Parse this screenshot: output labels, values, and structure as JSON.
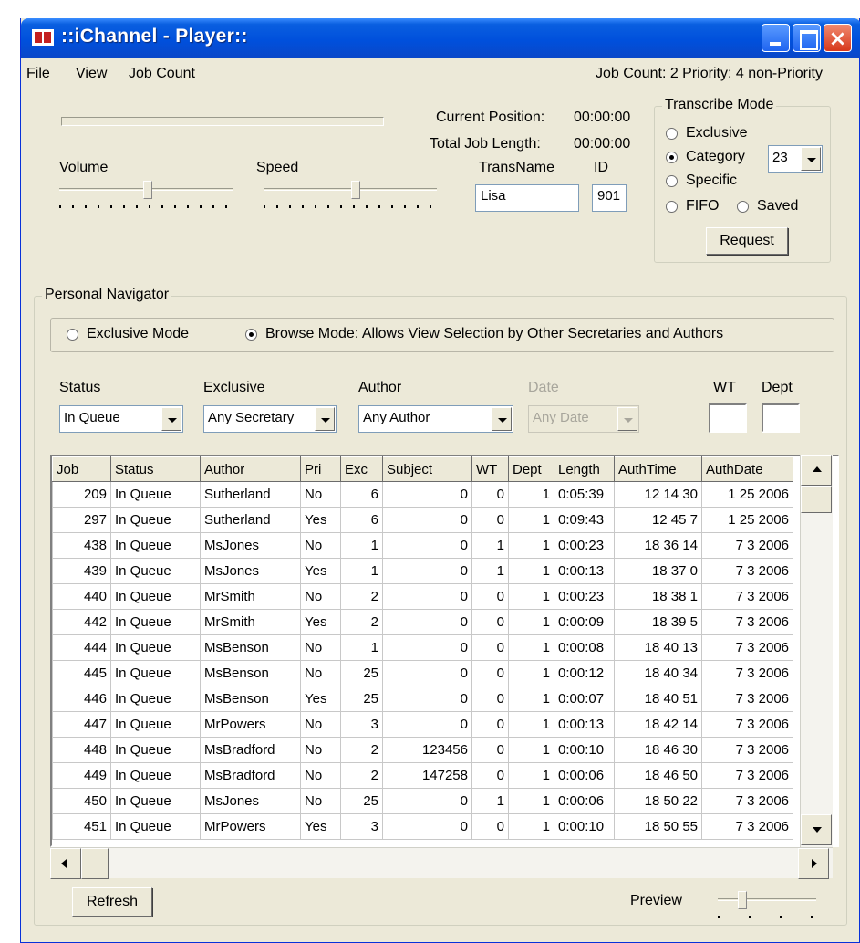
{
  "window": {
    "title": "::iChannel - Player::",
    "close_glyph": "×"
  },
  "menu": {
    "file": "File",
    "view": "View",
    "job_count": "Job Count"
  },
  "job_count_status": "Job Count: 2 Priority; 4 non-Priority",
  "player": {
    "current_position_label": "Current Position:",
    "current_position_value": "00:00:00",
    "total_length_label": "Total Job Length:",
    "total_length_value": "00:00:00",
    "volume_label": "Volume",
    "speed_label": "Speed",
    "transname_label": "TransName",
    "transname_value": "Lisa",
    "id_label": "ID",
    "id_value": "901"
  },
  "transcribe_mode": {
    "title": "Transcribe Mode",
    "exclusive": "Exclusive",
    "category": "Category",
    "category_value": "23",
    "specific": "Specific",
    "fifo": "FIFO",
    "saved": "Saved",
    "request_button": "Request",
    "selected": "Category"
  },
  "navigator": {
    "title": "Personal Navigator",
    "exclusive_mode": "Exclusive Mode",
    "browse_mode": "Browse Mode:  Allows View Selection by Other Secretaries and Authors",
    "selected_mode": "Browse Mode"
  },
  "filters": {
    "status_label": "Status",
    "status_value": "In Queue",
    "exclusive_label": "Exclusive",
    "exclusive_value": "Any Secretary",
    "author_label": "Author",
    "author_value": "Any Author",
    "date_label": "Date",
    "date_value": "Any Date",
    "wt_label": "WT",
    "dept_label": "Dept"
  },
  "table": {
    "columns": [
      "Job",
      "Status",
      "Author",
      "Pri",
      "Exc",
      "Subject",
      "WT",
      "Dept",
      "Length",
      "AuthTime",
      "AuthDate"
    ],
    "rows": [
      [
        "209",
        "In Queue",
        "Sutherland",
        "No",
        "6",
        "0",
        "0",
        "1",
        "0:05:39",
        "12 14 30",
        "1 25 2006"
      ],
      [
        "297",
        "In Queue",
        "Sutherland",
        "Yes",
        "6",
        "0",
        "0",
        "1",
        "0:09:43",
        "12 45 7",
        "1 25 2006"
      ],
      [
        "438",
        "In Queue",
        "MsJones",
        "No",
        "1",
        "0",
        "1",
        "1",
        "0:00:23",
        "18 36 14",
        "7 3 2006"
      ],
      [
        "439",
        "In Queue",
        "MsJones",
        "Yes",
        "1",
        "0",
        "1",
        "1",
        "0:00:13",
        "18 37 0",
        "7 3 2006"
      ],
      [
        "440",
        "In Queue",
        "MrSmith",
        "No",
        "2",
        "0",
        "0",
        "1",
        "0:00:23",
        "18 38 1",
        "7 3 2006"
      ],
      [
        "442",
        "In Queue",
        "MrSmith",
        "Yes",
        "2",
        "0",
        "0",
        "1",
        "0:00:09",
        "18 39 5",
        "7 3 2006"
      ],
      [
        "444",
        "In Queue",
        "MsBenson",
        "No",
        "1",
        "0",
        "0",
        "1",
        "0:00:08",
        "18 40 13",
        "7 3 2006"
      ],
      [
        "445",
        "In Queue",
        "MsBenson",
        "No",
        "25",
        "0",
        "0",
        "1",
        "0:00:12",
        "18 40 34",
        "7 3 2006"
      ],
      [
        "446",
        "In Queue",
        "MsBenson",
        "Yes",
        "25",
        "0",
        "0",
        "1",
        "0:00:07",
        "18 40 51",
        "7 3 2006"
      ],
      [
        "447",
        "In Queue",
        "MrPowers",
        "No",
        "3",
        "0",
        "0",
        "1",
        "0:00:13",
        "18 42 14",
        "7 3 2006"
      ],
      [
        "448",
        "In Queue",
        "MsBradford",
        "No",
        "2",
        "123456",
        "0",
        "1",
        "0:00:10",
        "18 46 30",
        "7 3 2006"
      ],
      [
        "449",
        "In Queue",
        "MsBradford",
        "No",
        "2",
        "147258",
        "0",
        "1",
        "0:00:06",
        "18 46 50",
        "7 3 2006"
      ],
      [
        "450",
        "In Queue",
        "MsJones",
        "No",
        "25",
        "0",
        "1",
        "1",
        "0:00:06",
        "18 50 22",
        "7 3 2006"
      ],
      [
        "451",
        "In Queue",
        "MrPowers",
        "Yes",
        "3",
        "0",
        "0",
        "1",
        "0:00:10",
        "18 50 55",
        "7 3 2006"
      ]
    ]
  },
  "footer": {
    "refresh_button": "Refresh",
    "preview_label": "Preview"
  }
}
